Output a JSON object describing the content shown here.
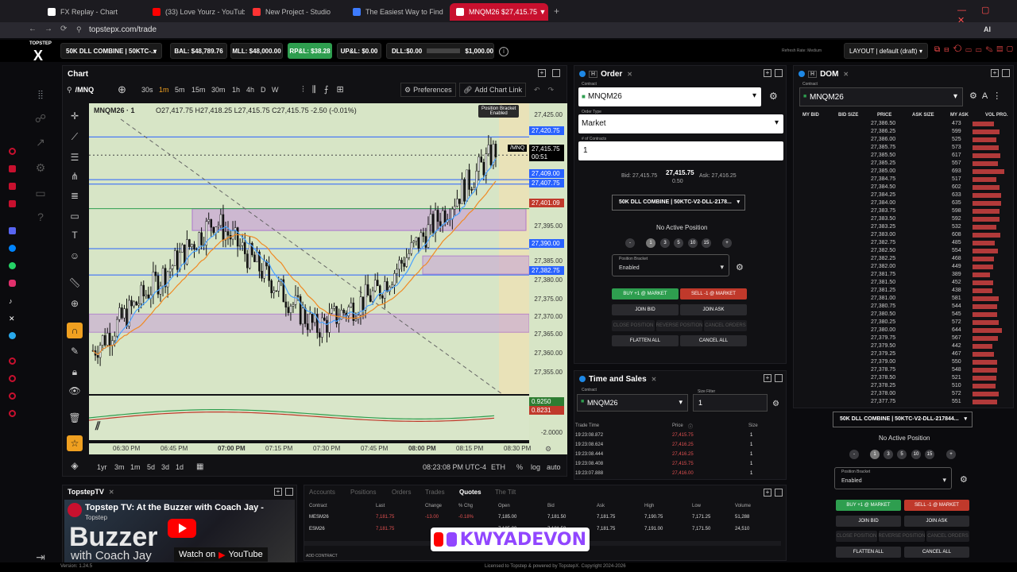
{
  "browser": {
    "tabs": [
      {
        "title": "FX Replay - Chart",
        "color": "#ffffff"
      },
      {
        "title": "(33) Love Yourz - YouTube",
        "color": "#ff0000"
      },
      {
        "title": "New Project - Studio",
        "color": "#ff3333"
      },
      {
        "title": "The Easiest Way to Find F",
        "color": "#3d7bff"
      },
      {
        "title": "MNQM26 $27,415.75 ▼",
        "color": "#ffffff"
      }
    ],
    "url": "topstepx.com/trade",
    "ai": "AI"
  },
  "account": {
    "logo": "TOPSTEP",
    "account_select": "50K DLL COMBINE | 50KTC-...",
    "bal": "BAL: $48,789.76",
    "mll": "MLL: $48,000.00",
    "rpl": "RP&L: $38.28",
    "upl": "UP&L: $0.00",
    "dll": "DLL:$0.00",
    "dll_limit": "$1,000.00",
    "refresh": "Refresh Rate: Medium",
    "layout": "LAYOUT | default (draft)"
  },
  "chart": {
    "title": "Chart",
    "symbol_search": "/MNQ",
    "timeframes": [
      "30s",
      "1m",
      "5m",
      "15m",
      "30m",
      "1h",
      "4h",
      "D",
      "W"
    ],
    "active_tf": "1m",
    "preferences": "Preferences",
    "add_chart_link": "Add Chart Link",
    "legend_symbol": "MNQM26 · 1",
    "ohlc": "O27,417.75 H27,418.25 L27,415.75 C27,415.75 -2.50 (-0.01%)",
    "position_bracket": "Position Bracket",
    "enabled": "Enabled",
    "price_ticks": [
      "27,425.00",
      "27,395.00",
      "27,385.00",
      "27,380.00",
      "27,375.00",
      "27,370.00",
      "27,365.00",
      "27,360.00",
      "27,355.00",
      "-2.0000"
    ],
    "price_labels": [
      {
        "text": "27,420.75",
        "color": "#2962ff"
      },
      {
        "text": "27,415.75",
        "color": "#000000"
      },
      {
        "text": "00:51",
        "color": "#000000"
      },
      {
        "text": "27,409.00",
        "color": "#2962ff"
      },
      {
        "text": "27,407.75",
        "color": "#2962ff"
      },
      {
        "text": "27,401.09",
        "color": "#c0392b"
      },
      {
        "text": "27,390.00",
        "color": "#2962ff"
      },
      {
        "text": "27,382.75",
        "color": "#2962ff"
      },
      {
        "text": "0.9250",
        "color": "#2e7d32"
      },
      {
        "text": "0.8231",
        "color": "#c0392b"
      }
    ],
    "sym_tag": "/MNQ",
    "time_ticks": [
      "06:30 PM",
      "06:45 PM",
      "07:00 PM",
      "07:15 PM",
      "07:30 PM",
      "07:45 PM",
      "08:00 PM",
      "08:15 PM",
      "08:30 PM"
    ],
    "ranges": [
      "1yr",
      "3m",
      "1m",
      "5d",
      "3d",
      "1d"
    ],
    "clock": "08:23:08 PM UTC-4",
    "session": "ETH",
    "pct": "%",
    "log": "log",
    "auto": "auto",
    "a": "A",
    "l": "L"
  },
  "order": {
    "title": "Order",
    "contract_label": "Contract",
    "contract": "MNQM26",
    "order_type_label": "Order Type",
    "order_type": "Market",
    "contracts_label": "# of Contracts",
    "contracts": "1",
    "bid": "Bid: 27,415.75",
    "last": "27,415.75",
    "spread": "0.50",
    "ask": "Ask: 27,416.25",
    "account": "50K DLL COMBINE | 50KTC-V2-DLL-2178...",
    "no_position": "No Active Position",
    "qty_buttons": [
      "-",
      "1",
      "3",
      "5",
      "10",
      "15",
      "+"
    ],
    "bracket_label": "Position Bracket",
    "bracket": "Enabled",
    "buy": "BUY +1 @ MARKET",
    "sell": "SELL -1 @ MARKET",
    "join_bid": "JOIN BID",
    "join_ask": "JOIN ASK",
    "close": "CLOSE POSITION",
    "reverse": "REVERSE POSITION",
    "cancel_orders": "CANCEL ORDERS",
    "flatten": "FLATTEN ALL",
    "cancel_all": "CANCEL ALL"
  },
  "ts": {
    "title": "Time and Sales",
    "contract_label": "Contract",
    "contract": "MNQM26",
    "size_label": "Size Filter",
    "size": "1",
    "cols": [
      "Trade Time",
      "Price",
      "Size"
    ],
    "rows": [
      [
        "19:23:08.872",
        "27,415.75",
        "1"
      ],
      [
        "19:23:08.624",
        "27,416.25",
        "1"
      ],
      [
        "19:23:08.444",
        "27,416.25",
        "1"
      ],
      [
        "19:23:08.408",
        "27,415.75",
        "1"
      ],
      [
        "19:23:07.888",
        "27,416.00",
        "1"
      ]
    ]
  },
  "dom": {
    "title": "DOM",
    "contract_label": "Contract",
    "contract": "MNQM26",
    "cols": [
      "MY BID",
      "BID SIZE",
      "PRICE",
      "ASK SIZE",
      "MY ASK",
      "VOL PRO."
    ],
    "rows": [
      [
        "27,386.50",
        "473"
      ],
      [
        "27,386.25",
        "599"
      ],
      [
        "27,386.00",
        "525"
      ],
      [
        "27,385.75",
        "573"
      ],
      [
        "27,385.50",
        "617"
      ],
      [
        "27,385.25",
        "557"
      ],
      [
        "27,385.00",
        "693"
      ],
      [
        "27,384.75",
        "517"
      ],
      [
        "27,384.50",
        "602"
      ],
      [
        "27,384.25",
        "633"
      ],
      [
        "27,384.00",
        "635"
      ],
      [
        "27,383.75",
        "598"
      ],
      [
        "27,383.50",
        "592"
      ],
      [
        "27,383.25",
        "532"
      ],
      [
        "27,383.00",
        "608"
      ],
      [
        "27,382.75",
        "485"
      ],
      [
        "27,382.50",
        "554"
      ],
      [
        "27,382.25",
        "468"
      ],
      [
        "27,382.00",
        "449"
      ],
      [
        "27,381.75",
        "389"
      ],
      [
        "27,381.50",
        "452"
      ],
      [
        "27,381.25",
        "438"
      ],
      [
        "27,381.00",
        "581"
      ],
      [
        "27,380.75",
        "544"
      ],
      [
        "27,380.50",
        "545"
      ],
      [
        "27,380.25",
        "572"
      ],
      [
        "27,380.00",
        "644"
      ],
      [
        "27,379.75",
        "567"
      ],
      [
        "27,379.50",
        "442"
      ],
      [
        "27,379.25",
        "467"
      ],
      [
        "27,379.00",
        "550"
      ],
      [
        "27,378.75",
        "548"
      ],
      [
        "27,378.50",
        "521"
      ],
      [
        "27,378.25",
        "510"
      ],
      [
        "27,378.00",
        "572"
      ],
      [
        "27,377.75",
        "551"
      ]
    ],
    "account": "50K DLL COMBINE | 50KTC-V2-DLL-217844...",
    "no_position": "No Active Position",
    "bracket_label": "Position Bracket",
    "bracket": "Enabled"
  },
  "yt": {
    "title": "TopstepTV",
    "video_title": "Topstep TV: At the Buzzer with Coach Jay -",
    "channel": "Topstep",
    "watch": "Watch on",
    "yt": "YouTube",
    "big1": "Buzzer",
    "big2": "with Coach Jay",
    "overlay": "KWYADEVON"
  },
  "quotes": {
    "tabs": [
      "Accounts",
      "Positions",
      "Orders",
      "Trades",
      "Quotes",
      "The Tilt"
    ],
    "active": "Quotes",
    "cols": [
      "Contract",
      "Last",
      "Change",
      "% Chg",
      "Open",
      "Bid",
      "Ask",
      "High",
      "Low",
      "Volume"
    ],
    "rows": [
      [
        "MESM26",
        "7,181.75",
        "-13.00",
        "-0.18%",
        "7,185.00",
        "7,181.50",
        "7,181.75",
        "7,190.75",
        "7,171.25",
        "51,288"
      ],
      [
        "ESM26",
        "7,181.75",
        "",
        "",
        "7,185.00",
        "7,181.50",
        "7,181.75",
        "7,191.00",
        "7,171.50",
        "24,510"
      ]
    ],
    "add": "ADD CONTRACT"
  },
  "footer": {
    "version": "Version: 1.24.5",
    "license": "Licensed to Topstep & powered by TopstepX. Copyright 2024-2026"
  }
}
